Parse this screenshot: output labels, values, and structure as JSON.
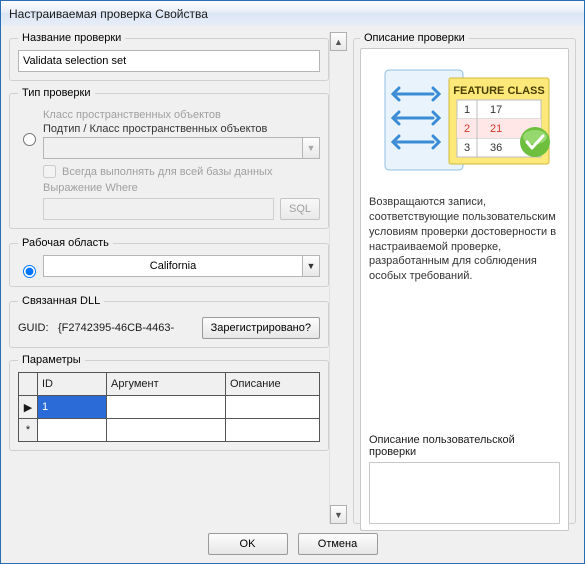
{
  "window": {
    "title": "Настраиваемая проверка Свойства"
  },
  "left": {
    "name_group": "Название проверки",
    "name_value": "Validata selection set",
    "type_group": "Тип проверки",
    "class_label": "Класс пространственных объектов",
    "subtype_label": "Подтип / Класс пространственных объектов",
    "always_label": "Всегда выполнять для всей базы данных",
    "where_label": "Выражение Where",
    "sql_btn": "SQL",
    "workspace_group": "Рабочая область",
    "workspace_value": "California",
    "dll_group": "Связанная DLL",
    "guid_label": "GUID:",
    "guid_value": "{F2742395-46CB-4463-",
    "register_btn": "Зарегистрировано?",
    "params_group": "Параметры",
    "params_cols": {
      "id": "ID",
      "arg": "Аргумент",
      "desc": "Описание"
    },
    "params_rows": [
      {
        "marker": "▶",
        "id": "1",
        "arg": "",
        "desc": ""
      },
      {
        "marker": "*",
        "id": "",
        "arg": "",
        "desc": ""
      }
    ]
  },
  "right": {
    "group": "Описание проверки",
    "feature_class_label": "FEATURE CLASS",
    "feature_rows": [
      {
        "n": "1",
        "v": "17"
      },
      {
        "n": "2",
        "v": "21"
      },
      {
        "n": "3",
        "v": "36"
      }
    ],
    "desc": "Возвращаются записи, соответствующие пользовательским условиям проверки достоверности в настраиваемой проверке, разработанным для соблюдения особых требований.",
    "user_desc_label": "Описание пользовательской проверки"
  },
  "buttons": {
    "ok": "OK",
    "cancel": "Отмена"
  }
}
